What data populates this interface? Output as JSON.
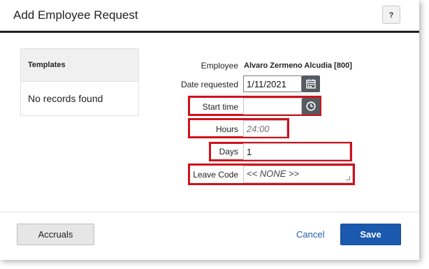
{
  "dialog": {
    "title": "Add Employee Request",
    "help_label": "?"
  },
  "templates": {
    "header": "Templates",
    "empty_text": "No records found"
  },
  "form": {
    "employee_label": "Employee",
    "employee_value": "Alvaro Zermeno Alcudia [800]",
    "date_label": "Date requested",
    "date_value": "1/11/2021",
    "start_time_label": "Start time",
    "start_time_value": "",
    "hours_label": "Hours",
    "hours_placeholder": "24:00",
    "days_label": "Days",
    "days_value": "1",
    "leave_code_label": "Leave Code",
    "leave_code_value": "<< NONE >>"
  },
  "footer": {
    "accruals_label": "Accruals",
    "cancel_label": "Cancel",
    "save_label": "Save"
  },
  "colors": {
    "highlight": "#d0111a",
    "primary": "#1a59ae",
    "icon_button": "#555b60"
  },
  "icons": [
    "calendar-icon",
    "clock-icon"
  ]
}
